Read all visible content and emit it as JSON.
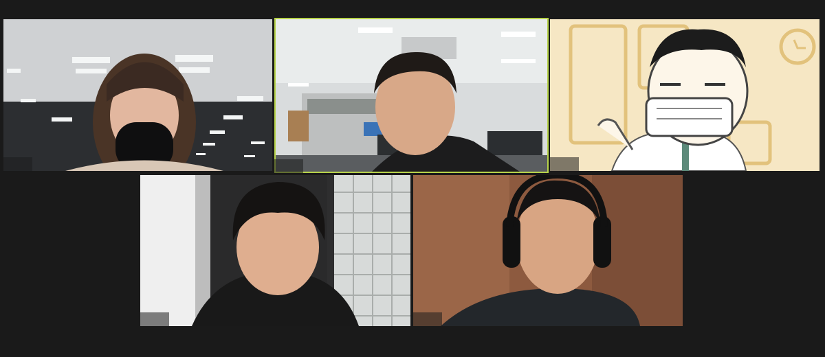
{
  "meeting": {
    "participants": [
      {
        "tile": "participant-1",
        "name": "",
        "video": "woman-black-mask-office"
      },
      {
        "tile": "participant-2",
        "name": "",
        "video": "man-smiling-office",
        "active_speaker": true
      },
      {
        "tile": "participant-3",
        "name": "",
        "video": "illustrated-avatar-mask"
      },
      {
        "tile": "participant-4",
        "name": "",
        "video": "man-smiling-glass-blocks"
      },
      {
        "tile": "participant-5",
        "name": "",
        "video": "man-headphones-wood-wall"
      }
    ]
  },
  "colors": {
    "background": "#1a1a1a",
    "active_speaker_border": "#b7d34a"
  }
}
